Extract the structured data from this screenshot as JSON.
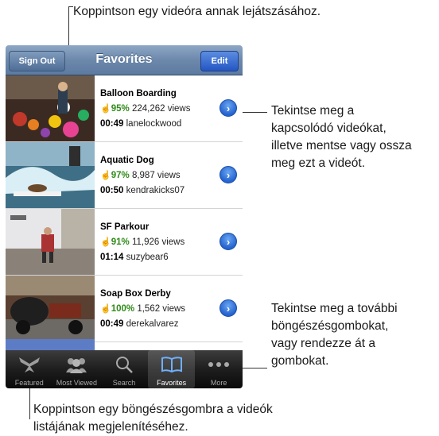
{
  "callouts": {
    "top": "Koppintson egy videóra annak lejátszásához.",
    "right_top": [
      "Tekintse meg a",
      "kapcsolódó videókat,",
      "illetve mentse vagy ossza",
      "meg ezt a videót."
    ],
    "right_bottom": [
      "Tekintse meg a további",
      "böngészésgombokat,",
      "vagy rendezze át a",
      "gombokat."
    ],
    "bottom": [
      "Koppintson egy böngészésgombra a videók",
      "listájának megjelenítéséhez."
    ]
  },
  "navbar": {
    "title": "Favorites",
    "left_button": "Sign Out",
    "right_button": "Edit"
  },
  "videos": [
    {
      "title": "Balloon Boarding",
      "rating": "95%",
      "views": "224,262 views",
      "duration": "00:49",
      "user": "lanelockwood"
    },
    {
      "title": "Aquatic Dog",
      "rating": "97%",
      "views": "8,987 views",
      "duration": "00:50",
      "user": "kendrakicks07"
    },
    {
      "title": "SF Parkour",
      "rating": "91%",
      "views": "11,926 views",
      "duration": "01:14",
      "user": "suzybear6"
    },
    {
      "title": "Soap Box Derby",
      "rating": "100%",
      "views": "1,562 views",
      "duration": "00:49",
      "user": "derekalvarez"
    }
  ],
  "tabs": [
    {
      "label": "Featured",
      "icon": "featured-icon"
    },
    {
      "label": "Most Viewed",
      "icon": "most-viewed-icon"
    },
    {
      "label": "Search",
      "icon": "search-icon"
    },
    {
      "label": "Favorites",
      "icon": "favorites-icon",
      "active": true
    },
    {
      "label": "More",
      "icon": "more-icon"
    }
  ],
  "colors": {
    "navbar": "#6c88ab",
    "edit_button": "#2456c4",
    "rating": "#2f8a18",
    "tabbar": "#1e1e1e"
  }
}
